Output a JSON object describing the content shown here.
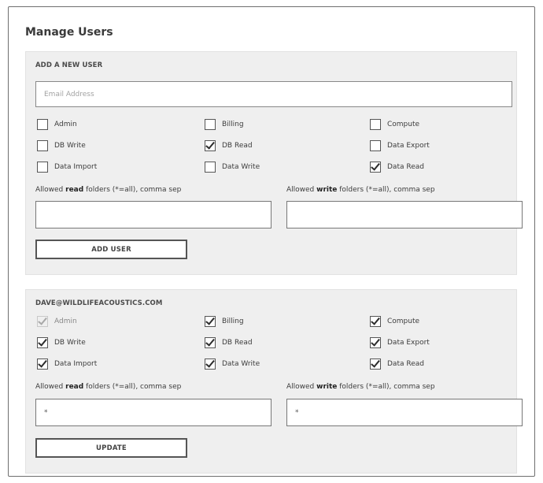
{
  "page": {
    "title": "Manage Users"
  },
  "add_user": {
    "section_title": "ADD A NEW USER",
    "email_placeholder": "Email Address",
    "permissions": [
      {
        "label": "Admin",
        "checked": false
      },
      {
        "label": "Billing",
        "checked": false
      },
      {
        "label": "Compute",
        "checked": false
      },
      {
        "label": "DB Write",
        "checked": false
      },
      {
        "label": "DB Read",
        "checked": true
      },
      {
        "label": "Data Export",
        "checked": false
      },
      {
        "label": "Data Import",
        "checked": false
      },
      {
        "label": "Data Write",
        "checked": false
      },
      {
        "label": "Data Read",
        "checked": true
      }
    ],
    "read_folders": {
      "label_pre": "Allowed ",
      "label_bold": "read",
      "label_post": " folders (*=all), comma sep",
      "value": ""
    },
    "write_folders": {
      "label_pre": "Allowed ",
      "label_bold": "write",
      "label_post": " folders (*=all), comma sep",
      "value": ""
    },
    "button_label": "ADD USER"
  },
  "user": {
    "email": "DAVE@WILDLIFEACOUSTICS.COM",
    "permissions": [
      {
        "label": "Admin",
        "checked": true,
        "disabled": true
      },
      {
        "label": "Billing",
        "checked": true
      },
      {
        "label": "Compute",
        "checked": true
      },
      {
        "label": "DB Write",
        "checked": true
      },
      {
        "label": "DB Read",
        "checked": true
      },
      {
        "label": "Data Export",
        "checked": true
      },
      {
        "label": "Data Import",
        "checked": true
      },
      {
        "label": "Data Write",
        "checked": true
      },
      {
        "label": "Data Read",
        "checked": true
      }
    ],
    "read_folders": {
      "label_pre": "Allowed ",
      "label_bold": "read",
      "label_post": " folders (*=all), comma sep",
      "value": "*"
    },
    "write_folders": {
      "label_pre": "Allowed ",
      "label_bold": "write",
      "label_post": " folders (*=all), comma sep",
      "value": "*"
    },
    "button_label": "UPDATE"
  }
}
